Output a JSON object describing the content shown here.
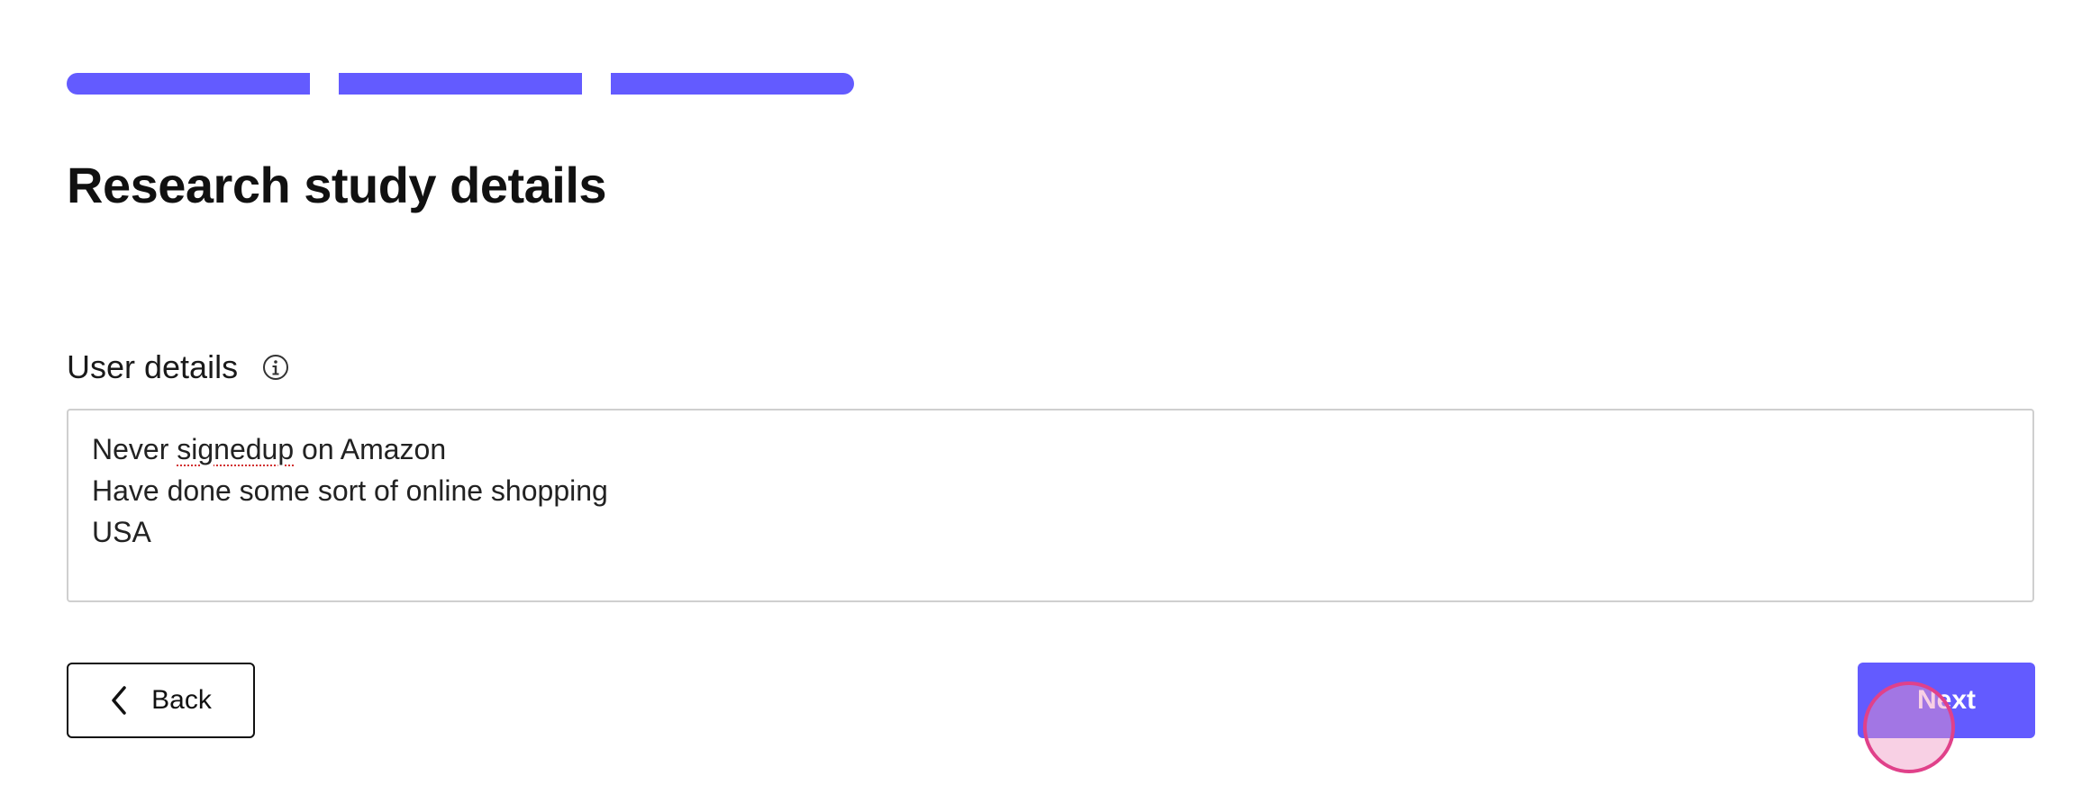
{
  "progress": {
    "steps_total": 3,
    "steps_completed": 3,
    "color": "#635bff"
  },
  "page": {
    "title": "Research study details"
  },
  "user_details": {
    "label": "User details",
    "info_icon": "info-icon",
    "lines": [
      "Never signedup on Amazon",
      "Have done some sort of online shopping",
      "USA"
    ],
    "misspelled_word": "signedup"
  },
  "buttons": {
    "back_label": "Back",
    "back_icon": "chevron-left-icon",
    "next_label": "Next",
    "next_color": "#635bff"
  },
  "cursor": {
    "type": "click-indicator",
    "color": "#e0418a"
  }
}
